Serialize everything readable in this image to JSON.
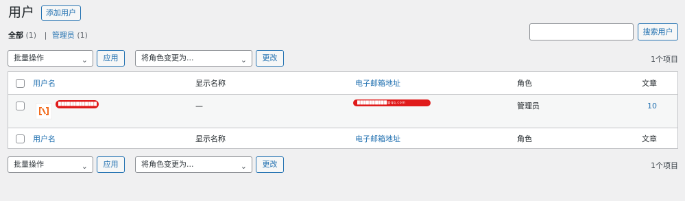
{
  "header": {
    "title": "用户",
    "add_new_label": "添加用户"
  },
  "filters": {
    "all_label": "全部",
    "all_count": "(1)",
    "admin_label": "管理员",
    "admin_count": "(1)"
  },
  "search": {
    "value": "",
    "button_label": "搜索用户"
  },
  "bulk": {
    "action_selected": "批量操作",
    "apply_label": "应用",
    "role_selected": "将角色变更为...",
    "change_label": "更改"
  },
  "items_count": "1个项目",
  "columns": {
    "username": "用户名",
    "display_name": "显示名称",
    "email": "电子邮箱地址",
    "role": "角色",
    "posts": "文章"
  },
  "rows": [
    {
      "username": "████████████████",
      "display_name": "—",
      "email": "██████████@qq.com",
      "role": "管理员",
      "posts": "10"
    }
  ],
  "colors": {
    "link": "#2271b1",
    "redaction": "#e01b1b",
    "avatar_orange": "#f26b1d"
  },
  "icons": {
    "dropdown": "chevron-down-icon",
    "avatar": "avatar-logo-icon"
  }
}
